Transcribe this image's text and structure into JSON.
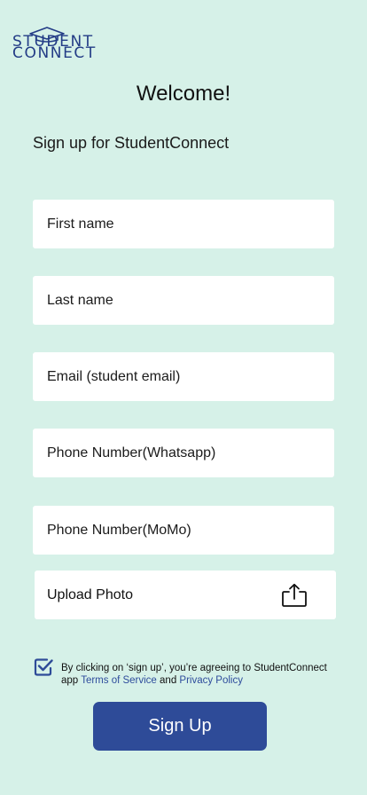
{
  "logo": {
    "line1": "STUDENT",
    "line2": "CONNECT",
    "color": "#233c86"
  },
  "header": {
    "title": "Welcome!",
    "subtitle": "Sign up for StudentConnect"
  },
  "form": {
    "first_name": {
      "placeholder": "First name",
      "value": ""
    },
    "last_name": {
      "placeholder": "Last name",
      "value": ""
    },
    "email": {
      "placeholder": "Email (student email)",
      "value": ""
    },
    "phone_whatsapp": {
      "placeholder": "Phone Number(Whatsapp)",
      "value": ""
    },
    "phone_momo": {
      "placeholder": "Phone Number(MoMo)",
      "value": ""
    },
    "upload_label": "Upload Photo",
    "upload_icon": "share-upload-icon"
  },
  "agreement": {
    "checked": true,
    "checkbox_icon": "checkbox-checked-icon",
    "text_before": "By clicking on ‘sign up’, you’re agreeing to StudentConnect app ",
    "terms_link": "Terms of Service",
    "and": " and ",
    "privacy_link": "Privacy Policy"
  },
  "signup_button": "Sign Up",
  "colors": {
    "background": "#d6f1e8",
    "primary": "#2e4b98",
    "link": "#2e4c9c",
    "field": "#ffffff"
  }
}
